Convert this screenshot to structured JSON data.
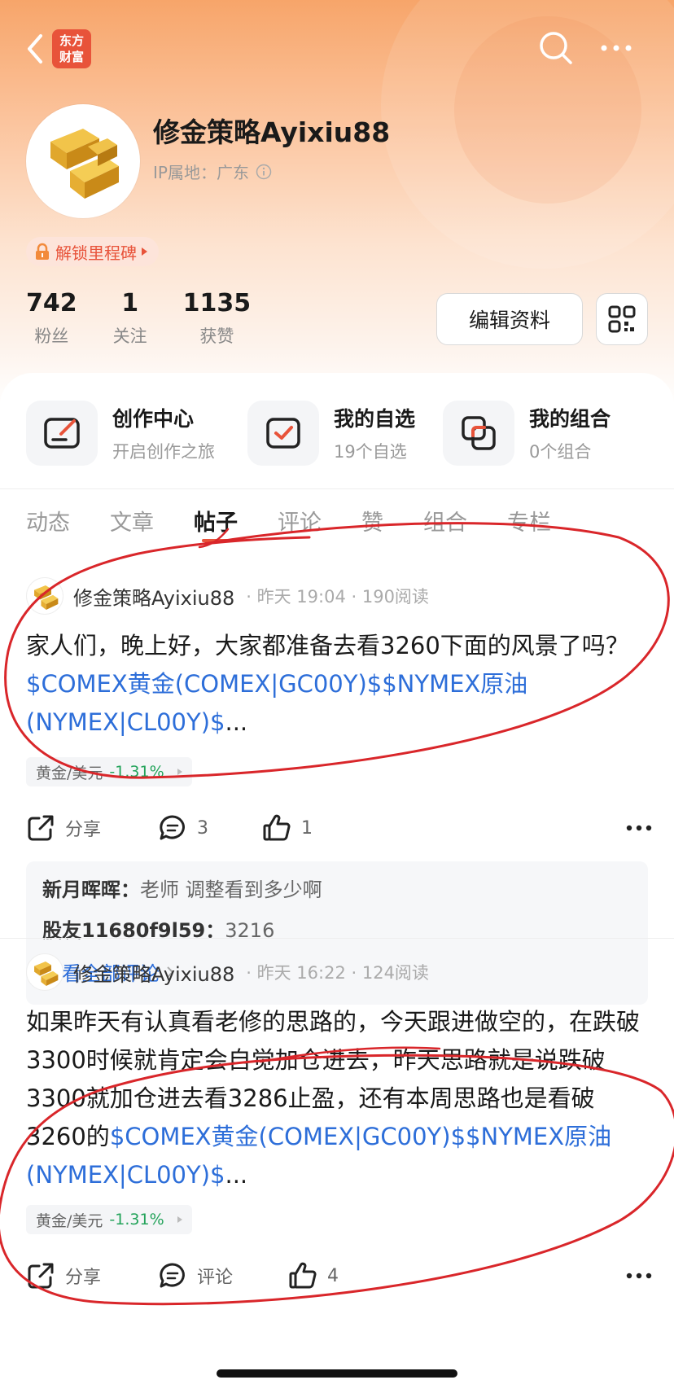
{
  "app": {
    "logo_text": "东方财富"
  },
  "profile": {
    "username": "修金策略Ayixiu88",
    "ip_label": "IP属地：广东",
    "milestone": "解锁里程碑",
    "stats": [
      {
        "value": "742",
        "label": "粉丝"
      },
      {
        "value": "1",
        "label": "关注"
      },
      {
        "value": "1135",
        "label": "获赞"
      }
    ],
    "edit_label": "编辑资料"
  },
  "quick": [
    {
      "title": "创作中心",
      "sub": "开启创作之旅",
      "icon": "creation-icon"
    },
    {
      "title": "我的自选",
      "sub": "19个自选",
      "icon": "watchlist-icon"
    },
    {
      "title": "我的组合",
      "sub": "0个组合",
      "icon": "portfolio-icon"
    }
  ],
  "tabs": [
    "动态",
    "文章",
    "帖子",
    "评论",
    "赞",
    "组合",
    "专栏"
  ],
  "active_tab": 2,
  "posts": [
    {
      "author": "修金策略Ayixiu88",
      "meta": "· 昨天 19:04 · 190阅读",
      "text": "家人们，晚上好，大家都准备去看3260下面的风景了吗？",
      "link": "$COMEX黄金(COMEX|GC00Y)$$NYMEX原油(NYMEX|CL00Y)$",
      "ellipsis": "...",
      "tag": "黄金/美元",
      "tag_change": "-1.31%",
      "share": "分享",
      "comments": "3",
      "likes": "1",
      "comment_list": [
        {
          "user": "新月晖晖：",
          "text": "老师 调整看到多少啊"
        },
        {
          "user": "股友11680f9l59：",
          "text": "3216"
        }
      ],
      "view_all": "查看全部评论"
    },
    {
      "author": "修金策略Ayixiu88",
      "meta": "· 昨天 16:22 · 124阅读",
      "text": "如果昨天有认真看老修的思路的，今天跟进做空的，在跌破3300时候就肯定会自觉加仓进去，昨天思路就是说跌破3300就加仓进去看3286止盈，还有本周思路也是看破3260的",
      "link": "$COMEX黄金(COMEX|GC00Y)$$NYMEX原油(NYMEX|CL00Y)$",
      "ellipsis": "...",
      "tag": "黄金/美元",
      "tag_change": "-1.31%",
      "share": "分享",
      "comments": "评论",
      "likes": "4"
    }
  ],
  "colors": {
    "accent": "#e8533a",
    "link": "#2d6ed9",
    "down": "#23a35a",
    "annotation": "#d9262a"
  }
}
